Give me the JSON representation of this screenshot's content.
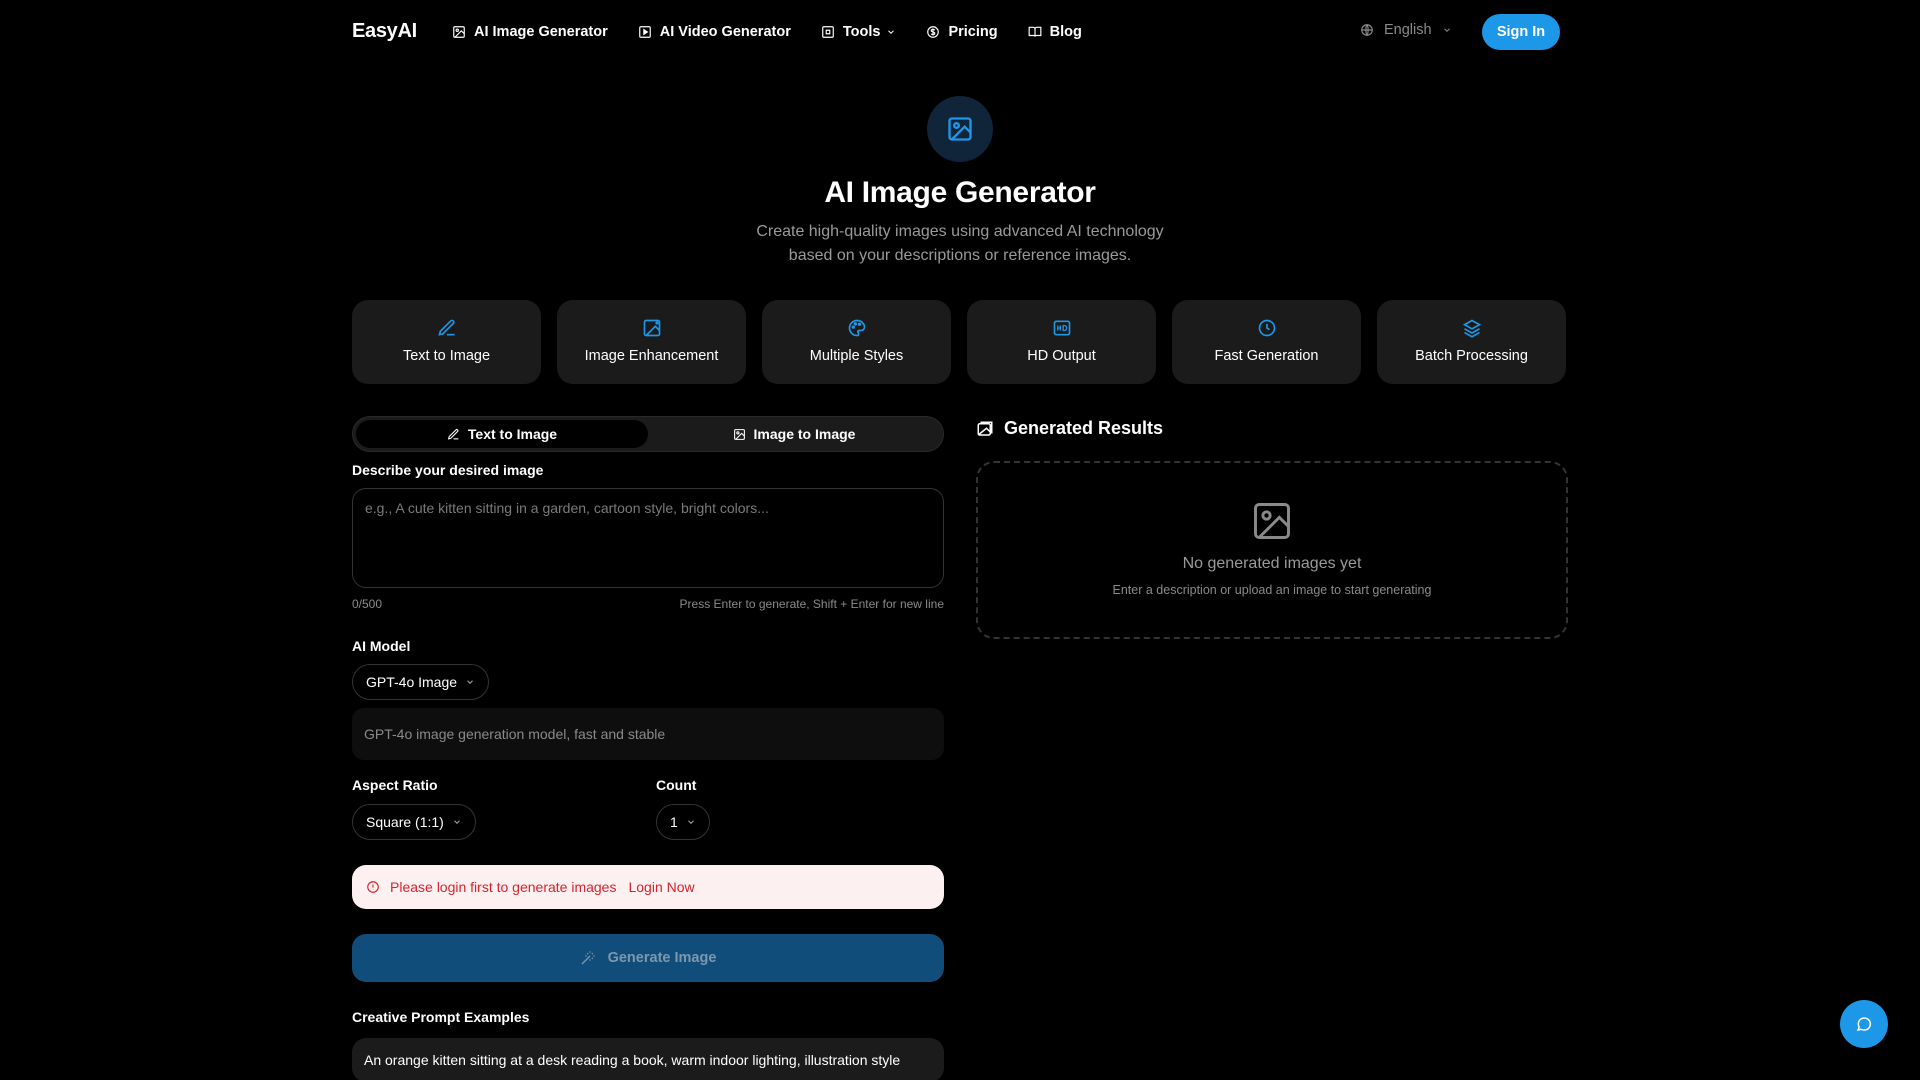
{
  "header": {
    "logo": "EasyAI",
    "nav": [
      {
        "label": "AI Image Generator",
        "icon": "image-icon"
      },
      {
        "label": "AI Video Generator",
        "icon": "video-icon"
      },
      {
        "label": "Tools",
        "icon": "tools-icon"
      },
      {
        "label": "Pricing",
        "icon": "dollar-icon"
      },
      {
        "label": "Blog",
        "icon": "book-icon"
      }
    ],
    "language": "English",
    "sign_in": "Sign In"
  },
  "hero": {
    "title": "AI Image Generator",
    "subtitle_line1": "Create high-quality images using advanced AI technology",
    "subtitle_line2": "based on your descriptions or reference images."
  },
  "features": [
    {
      "label": "Text to Image",
      "icon": "pencil-icon"
    },
    {
      "label": "Image Enhancement",
      "icon": "image-enhance-icon"
    },
    {
      "label": "Multiple Styles",
      "icon": "palette-icon"
    },
    {
      "label": "HD Output",
      "icon": "hd-icon"
    },
    {
      "label": "Fast Generation",
      "icon": "clock-icon"
    },
    {
      "label": "Batch Processing",
      "icon": "layers-icon"
    }
  ],
  "form": {
    "modes": [
      "Text to Image",
      "Image to Image"
    ],
    "active_mode": "Text to Image",
    "prompt_label": "Describe your desired image",
    "prompt_placeholder": "e.g., A cute kitten sitting in a garden, cartoon style, bright colors...",
    "prompt_value": "",
    "counter": "0/500",
    "hint": "Press Enter to generate, Shift + Enter for new line",
    "model_label": "AI Model",
    "model_value": "GPT-4o Image",
    "model_description": "GPT-4o image generation model, fast and stable",
    "aspect_label": "Aspect Ratio",
    "aspect_value": "Square (1:1)",
    "count_label": "Count",
    "count_value": "1",
    "alert_text": "Please login first to generate images",
    "alert_link": "Login Now",
    "generate_label": "Generate Image",
    "examples_label": "Creative Prompt Examples",
    "examples": [
      "An orange kitten sitting at a desk reading a book, warm indoor lighting, illustration style"
    ]
  },
  "results": {
    "title": "Generated Results",
    "empty_title": "No generated images yet",
    "empty_subtitle": "Enter a description or upload an image to start generating"
  },
  "colors": {
    "accent": "#1d97e8",
    "generate_button": "#114d7a",
    "alert_bg": "#fdf0f0",
    "alert_text": "#d9232e"
  }
}
